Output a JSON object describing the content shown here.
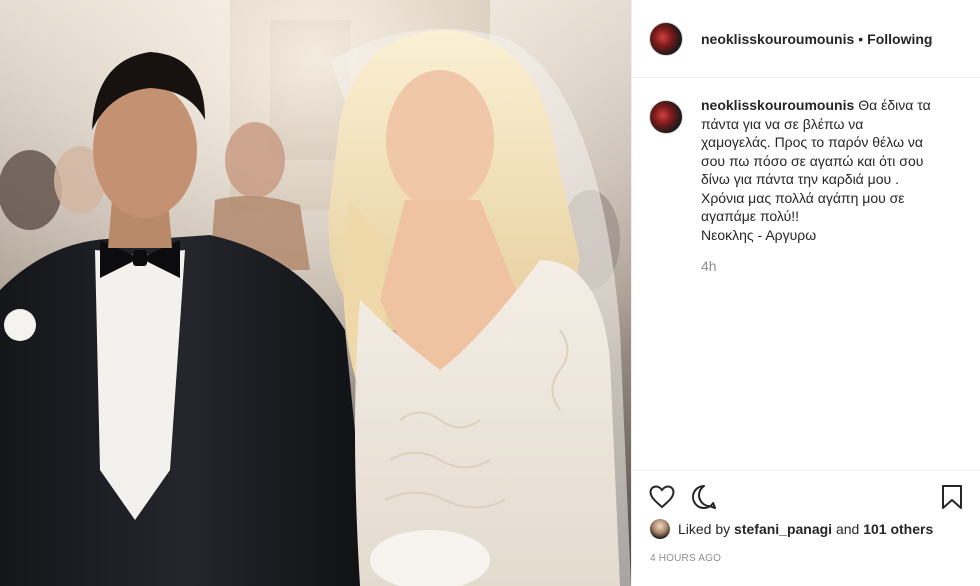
{
  "post": {
    "image_alt": "wedding photo",
    "header": {
      "username": "neoklisskouroumounis",
      "separator": "•",
      "follow_state": "Following"
    },
    "caption": {
      "username": "neoklisskouroumounis",
      "text": "Θα έδινα τα\nπάντα για να σε βλέπω να\nχαμογελάς. Προς το παρόν θέλω να\nσου πω πόσο σε αγαπώ και ότι σου\nδίνω για πάντα την καρδιά μου .\nΧρόνια μας πολλά αγάπη μου σε\nαγαπάμε πολύ!!\nΝεοκλης - Αργυρω",
      "time_ago": "4h"
    },
    "actions": {
      "like_icon": "heart-icon",
      "comment_icon": "comment-icon",
      "save_icon": "bookmark-icon"
    },
    "likes": {
      "prefix": "Liked by",
      "user": "stefani_panagi",
      "and": "and",
      "others": "101 others"
    },
    "timestamp": "4 HOURS AGO"
  },
  "colors": {
    "text_primary": "#262626",
    "text_secondary": "#8e8e8e",
    "border": "#efefef"
  }
}
